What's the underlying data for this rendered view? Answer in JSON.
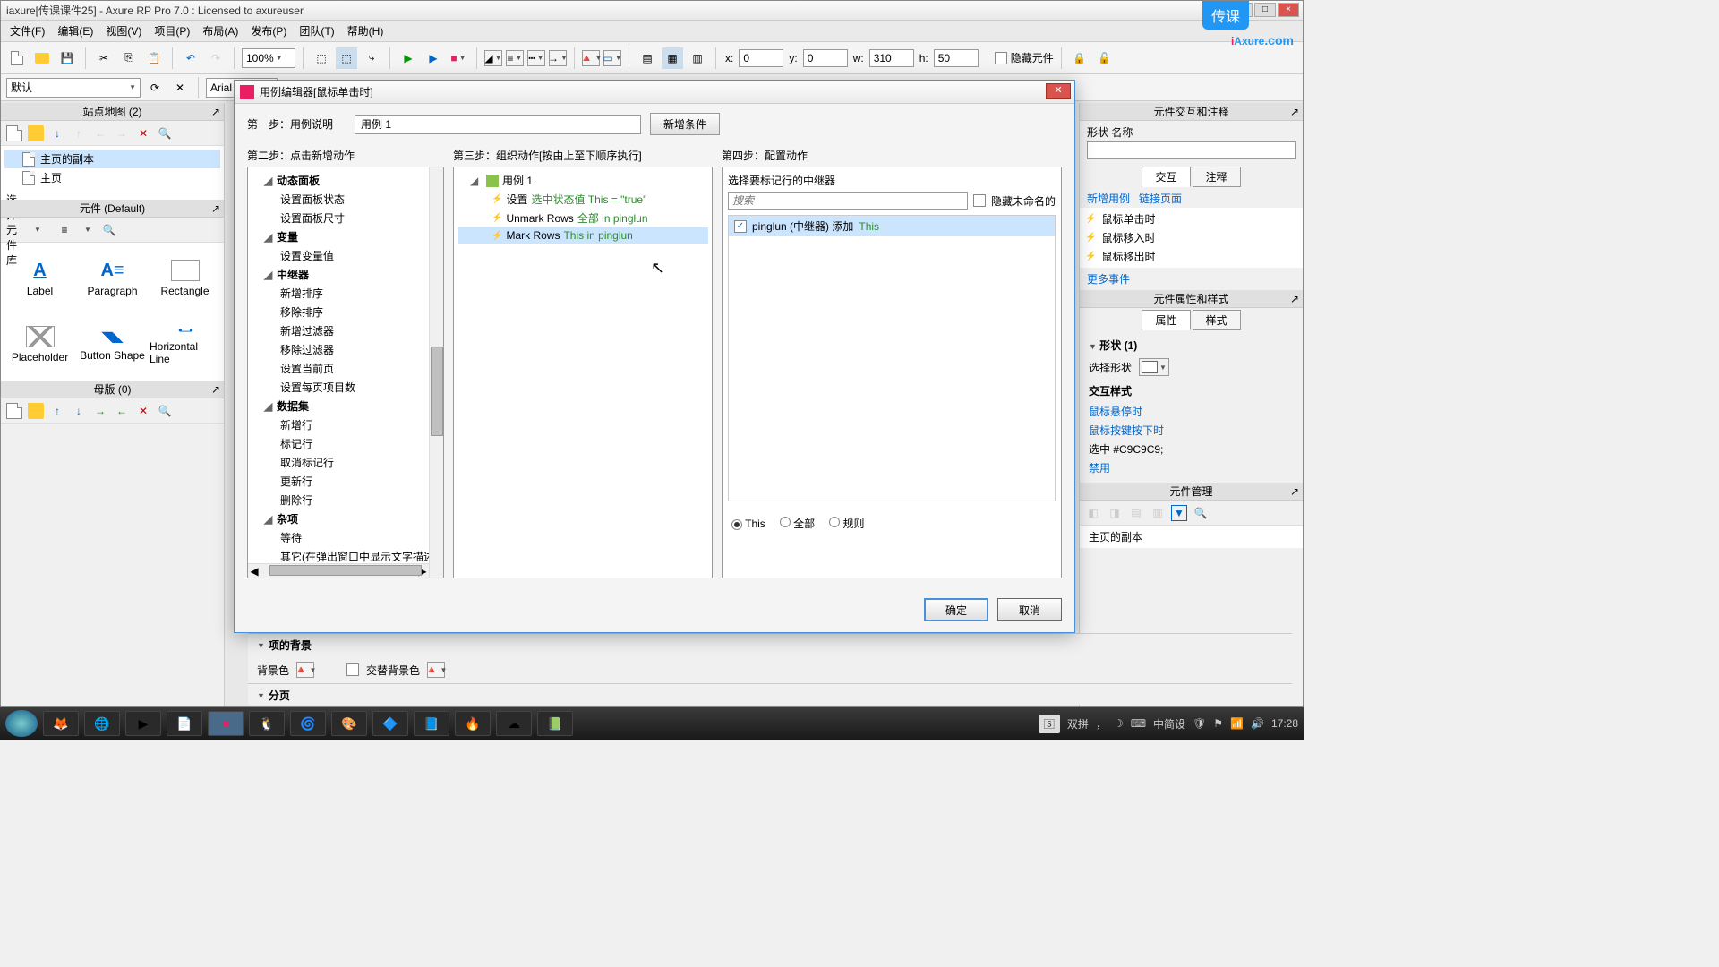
{
  "window": {
    "title": "iaxure[传课课件25] - Axure RP Pro 7.0 : Licensed to axureuser"
  },
  "menu": {
    "file": "文件(F)",
    "edit": "编辑(E)",
    "view": "视图(V)",
    "project": "项目(P)",
    "arrange": "布局(A)",
    "publish": "发布(P)",
    "team": "团队(T)",
    "help": "帮助(H)"
  },
  "toolbar": {
    "zoom": "100%",
    "x_label": "x:",
    "x_val": "0",
    "y_label": "y:",
    "y_val": "0",
    "w_label": "w:",
    "w_val": "310",
    "h_label": "h:",
    "h_val": "50",
    "hide_widgets": "隐藏元件"
  },
  "secondbar": {
    "style": "默认",
    "font": "Arial"
  },
  "logo": {
    "i": "i",
    "rest": "Axure",
    "dotcom": ".com",
    "badge": "传课"
  },
  "sitemap": {
    "title": "站点地图 (2)",
    "page1": "主页的副本",
    "page2": "主页"
  },
  "widgets": {
    "title": "元件 (Default)",
    "selector": "选择元件库",
    "items": [
      "Label",
      "Paragraph",
      "Rectangle",
      "Placeholder",
      "Button Shape",
      "Horizontal Line"
    ]
  },
  "masters": {
    "title": "母版 (0)"
  },
  "interactions_panel": {
    "title": "元件交互和注释",
    "shape_name_label": "形状 名称",
    "tab_interactions": "交互",
    "tab_notes": "注释",
    "add_case": "新增用例",
    "link_page": "链接页面",
    "on_click": "鼠标单击时",
    "on_mouse_enter": "鼠标移入时",
    "on_mouse_leave": "鼠标移出时",
    "more_events": "更多事件"
  },
  "properties_panel": {
    "title": "元件属性和样式",
    "tab_properties": "属性",
    "tab_style": "样式",
    "shape_count": "形状 (1)",
    "select_shape": "选择形状",
    "interaction_styles": "交互样式",
    "mouse_hover": "鼠标悬停时",
    "mouse_down": "鼠标按键按下时",
    "selected_color": "选中  #C9C9C9;",
    "disabled": "禁用"
  },
  "management_panel": {
    "title": "元件管理",
    "root": "主页的副本"
  },
  "bottom": {
    "item_bg": "项的背景",
    "bg_color": "背景色",
    "alt_bg": "交替背景色",
    "pagination": "分页"
  },
  "dialog": {
    "title": "用例编辑器[鼠标单击时]",
    "step1_label": "第一步：用例说明",
    "case_name": "用例 1",
    "add_condition": "新增条件",
    "step2_label": "第二步：点击新增动作",
    "step3_label": "第三步：组织动作[按由上至下顺序执行]",
    "step4_label": "第四步：配置动作",
    "actions": {
      "dynamic_panel": "动态面板",
      "set_panel_state": "设置面板状态",
      "set_panel_size": "设置面板尺寸",
      "variables": "变量",
      "set_variable": "设置变量值",
      "repeater": "中继器",
      "new_sort": "新增排序",
      "remove_sort": "移除排序",
      "new_filter": "新增过滤器",
      "remove_filter": "移除过滤器",
      "set_current_page": "设置当前页",
      "set_items_per_page": "设置每页项目数",
      "dataset": "数据集",
      "add_row": "新增行",
      "mark_row": "标记行",
      "unmark_row": "取消标记行",
      "update_row": "更新行",
      "delete_row": "删除行",
      "misc": "杂项",
      "wait": "等待",
      "other": "其它(在弹出窗口中显示文字描述"
    },
    "case_tree": {
      "case1": "用例 1",
      "set_value": "设置 ",
      "set_value_green": "选中状态值 This = \"true\"",
      "unmark": "Unmark Rows ",
      "unmark_green": "全部 in pinglun",
      "mark": "Mark Rows ",
      "mark_green": "This in pinglun"
    },
    "config": {
      "select_repeater": "选择要标记行的中继器",
      "search_placeholder": "搜索",
      "hide_unnamed": "隐藏未命名的",
      "pinglun": "pinglun (中继器) 添加 ",
      "pinglun_green": "This",
      "radio_this": "This",
      "radio_all": "全部",
      "radio_rule": "规则"
    },
    "ok": "确定",
    "cancel": "取消"
  },
  "taskbar": {
    "ime": "双拼",
    "ime2": "中简设",
    "clock": "17:28"
  }
}
